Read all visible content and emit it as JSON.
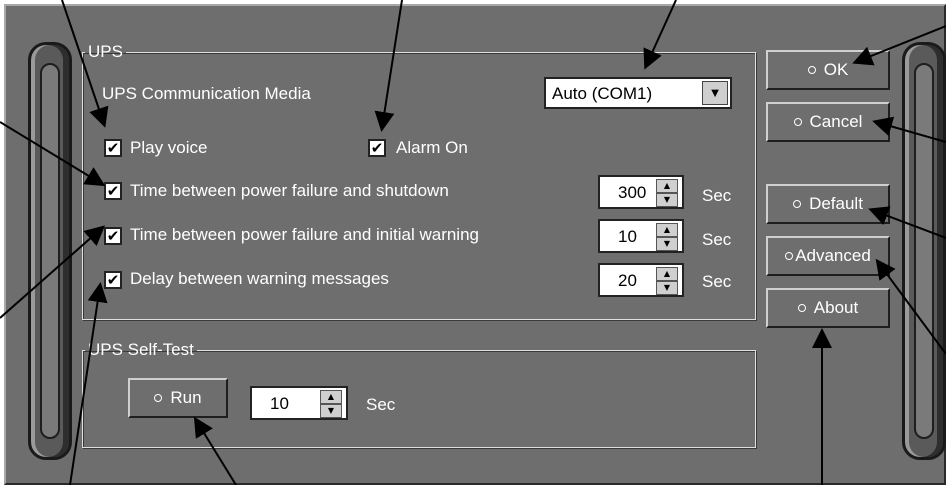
{
  "ups_group": {
    "legend": "UPS",
    "comm_media_label": "UPS Communication Media",
    "comm_media_value": "Auto (COM1)",
    "play_voice_label": "Play voice",
    "alarm_on_label": "Alarm On",
    "shutdown_label": "Time between power failure and shutdown",
    "shutdown_value": "300",
    "warning_label": "Time between power failure and initial warning",
    "warning_value": "10",
    "delay_label": "Delay between warning messages",
    "delay_value": "20",
    "unit": "Sec"
  },
  "selftest_group": {
    "legend": "UPS Self-Test",
    "run_label": "Run",
    "run_value": "10",
    "unit": "Sec"
  },
  "buttons": {
    "ok": "OK",
    "cancel": "Cancel",
    "default": "Default",
    "advanced": "Advanced",
    "about": "About"
  },
  "colors": {
    "window_bg": "#6e6e6e",
    "text": "#ffffff"
  }
}
